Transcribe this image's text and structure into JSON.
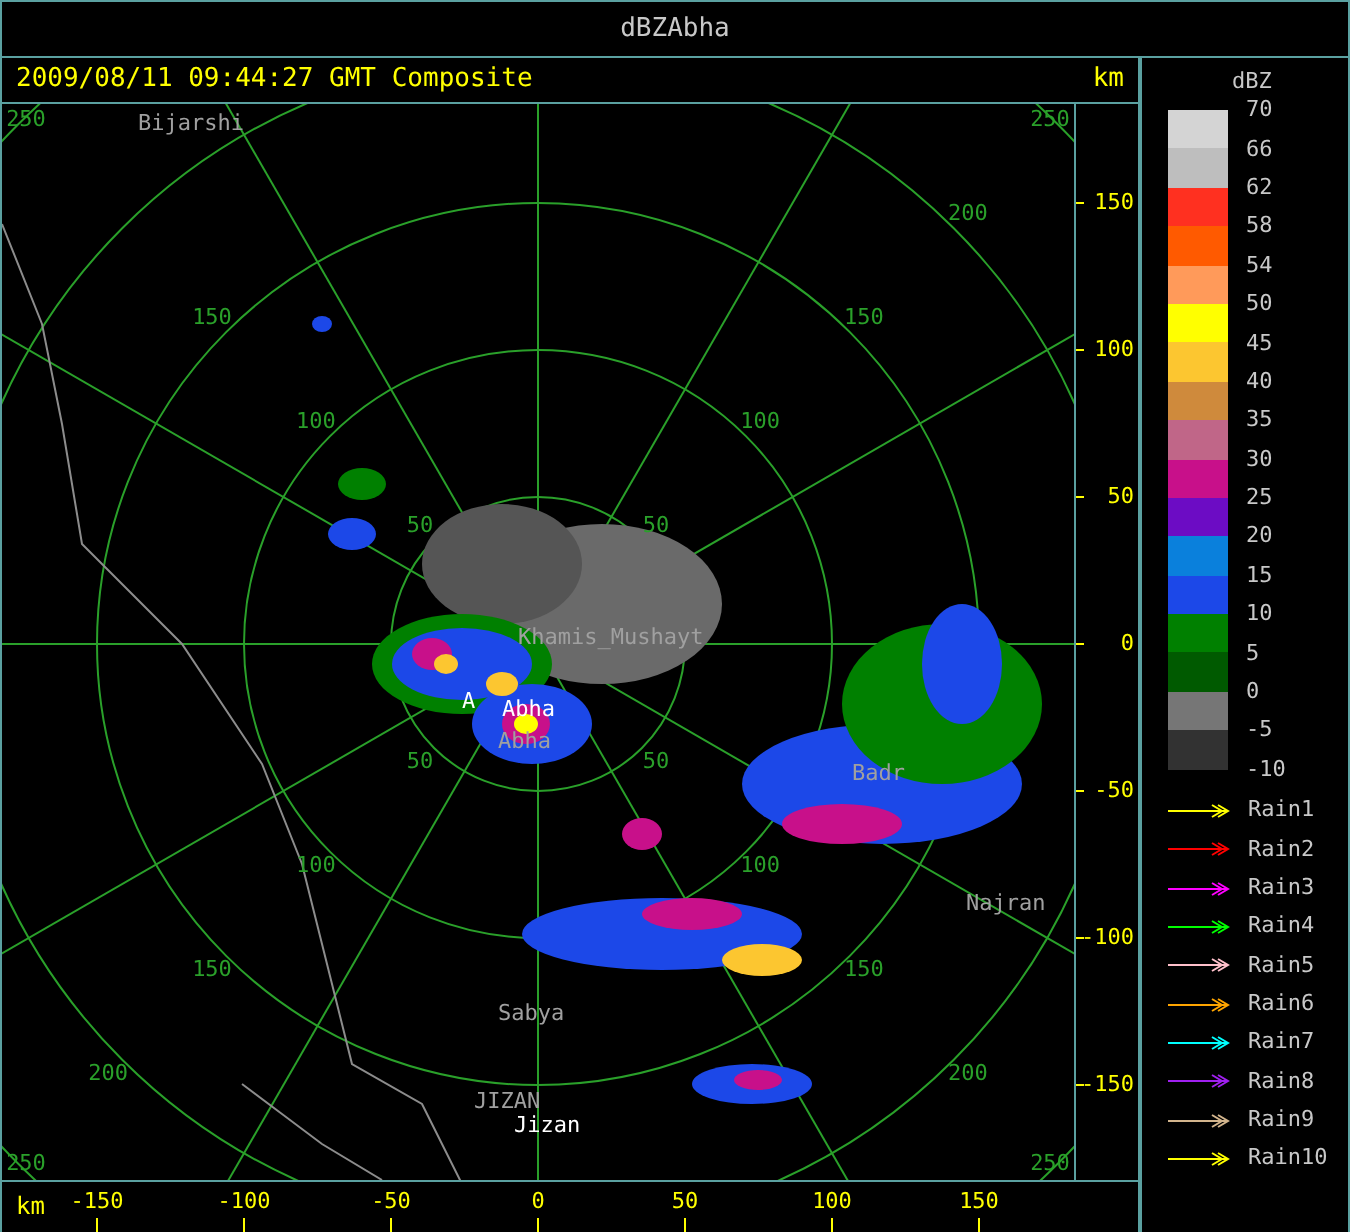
{
  "window": {
    "title": "dBZAbha"
  },
  "header": {
    "timestamp": "2009/08/11 09:44:27 GMT Composite",
    "unit": "km"
  },
  "map_labels": [
    {
      "text": "Bijarshi",
      "kind": "town"
    },
    {
      "text": "Khamis_Mushayt",
      "kind": "town"
    },
    {
      "text": "Abha",
      "kind": "town"
    },
    {
      "text": "A",
      "kind": "radar"
    },
    {
      "text": "Abha",
      "kind": "radar"
    },
    {
      "text": "Badr",
      "kind": "town"
    },
    {
      "text": "Najran",
      "kind": "town"
    },
    {
      "text": "Sabya",
      "kind": "town"
    },
    {
      "text": "JIZAN",
      "kind": "town"
    },
    {
      "text": "Jizan",
      "kind": "radar"
    }
  ],
  "ring_labels": [
    "50",
    "50",
    "50",
    "50",
    "100",
    "100",
    "100",
    "100",
    "150",
    "150",
    "150",
    "150",
    "200",
    "200",
    "200",
    "250",
    "250",
    "250",
    "250"
  ],
  "right_axis": [
    "150",
    "100",
    "50",
    "0",
    "-50",
    "-100",
    "-150"
  ],
  "bottom_axis": {
    "unit": "km",
    "ticks": [
      "-150",
      "-100",
      "-50",
      "0",
      "50",
      "100",
      "150"
    ]
  },
  "legend": {
    "title": "dBZ",
    "labels": [
      "70",
      "66",
      "62",
      "58",
      "54",
      "50",
      "45",
      "40",
      "35",
      "30",
      "25",
      "20",
      "15",
      "10",
      "5",
      "0",
      "-5",
      "-10"
    ],
    "steps": [
      {
        "color": "#d4d4d4"
      },
      {
        "color": "#bebebe"
      },
      {
        "color": "#ff3020"
      },
      {
        "color": "#ff5a00"
      },
      {
        "color": "#ff9a5a"
      },
      {
        "color": "#ffff00"
      },
      {
        "color": "#fcc630"
      },
      {
        "color": "#cf8a3c"
      },
      {
        "color": "#c06688"
      },
      {
        "color": "#c8108a"
      },
      {
        "color": "#6c0cc4"
      },
      {
        "color": "#0a80dc"
      },
      {
        "color": "#1c48e8"
      },
      {
        "color": "#008000"
      },
      {
        "color": "#005a00"
      },
      {
        "color": "#767676"
      },
      {
        "color": "#323232"
      }
    ]
  },
  "tracks": [
    {
      "name": "Rain1",
      "color": "#ffff00"
    },
    {
      "name": "Rain2",
      "color": "#ff0000"
    },
    {
      "name": "Rain3",
      "color": "#ff00ff"
    },
    {
      "name": "Rain4",
      "color": "#00ff00"
    },
    {
      "name": "Rain5",
      "color": "#ffc0cb"
    },
    {
      "name": "Rain6",
      "color": "#ffa500"
    },
    {
      "name": "Rain7",
      "color": "#00ffff"
    },
    {
      "name": "Rain8",
      "color": "#a020f0"
    },
    {
      "name": "Rain9",
      "color": "#d2b48c"
    },
    {
      "name": "Rain10",
      "color": "#ffff00"
    }
  ]
}
